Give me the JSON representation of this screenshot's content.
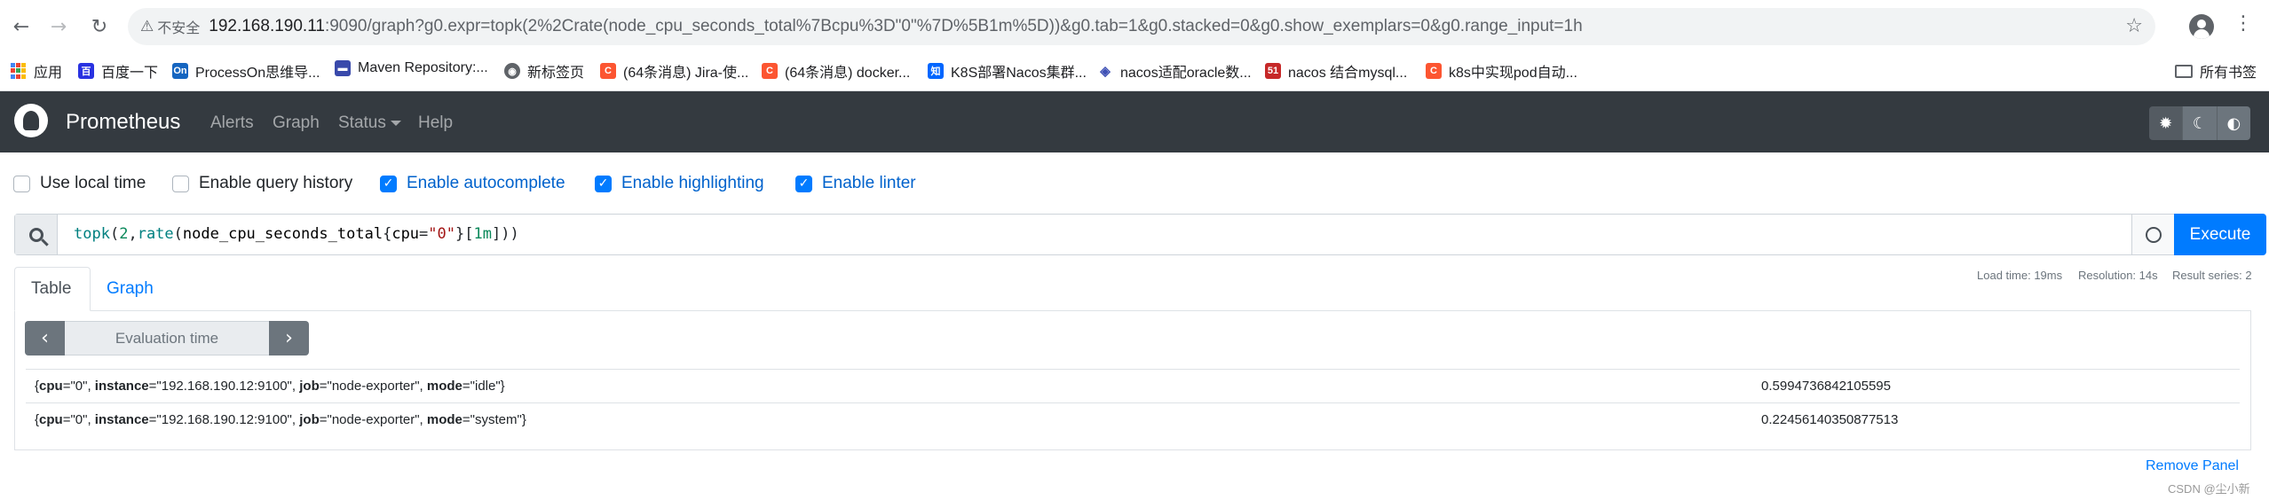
{
  "browser": {
    "insecure_label": "不安全",
    "url_host": "192.168.190.11",
    "url_rest": ":9090/graph?g0.expr=topk(2%2Crate(node_cpu_seconds_total%7Bcpu%3D\"0\"%7D%5B1m%5D))&g0.tab=1&g0.stacked=0&g0.show_exemplars=0&g0.range_input=1h",
    "icons": [
      "back-icon",
      "forward-icon",
      "reload-icon",
      "star-icon",
      "profile-icon",
      "menu-icon"
    ]
  },
  "bookmarks": {
    "items": [
      {
        "label": "应用",
        "icon": "apps-icon",
        "color": "#4285f4"
      },
      {
        "label": "百度一下",
        "icon": "baidu-icon",
        "color": "#2932e1"
      },
      {
        "label": "ProcessOn思维导...",
        "icon": "processon-icon",
        "color": "#1565c0"
      },
      {
        "label": "Maven Repository:...",
        "icon": "maven-icon",
        "color": "#3949ab"
      },
      {
        "label": "新标签页",
        "icon": "globe-icon",
        "color": "#5f6368"
      },
      {
        "label": "(64条消息) Jira-使...",
        "icon": "csdn-icon",
        "color": "#fc5531"
      },
      {
        "label": "(64条消息) docker...",
        "icon": "csdn-icon",
        "color": "#fc5531"
      },
      {
        "label": "K8S部署Nacos集群...",
        "icon": "zhihu-icon",
        "color": "#0066ff"
      },
      {
        "label": "nacos适配oracle数...",
        "icon": "diamond-icon",
        "color": "#3f51b5"
      },
      {
        "label": "nacos 结合mysql...",
        "icon": "51cto-icon",
        "color": "#c62828"
      },
      {
        "label": "k8s中实现pod自动...",
        "icon": "csdn-icon",
        "color": "#fc5531"
      }
    ],
    "all_label": "所有书签"
  },
  "navbar": {
    "brand": "Prometheus",
    "links": [
      "Alerts",
      "Graph",
      "Status",
      "Help"
    ],
    "theme_icons": [
      "sun-icon",
      "moon-icon",
      "contrast-icon"
    ]
  },
  "options": [
    {
      "label": "Use local time",
      "checked": false
    },
    {
      "label": "Enable query history",
      "checked": false
    },
    {
      "label": "Enable autocomplete",
      "checked": true
    },
    {
      "label": "Enable highlighting",
      "checked": true
    },
    {
      "label": "Enable linter",
      "checked": true
    }
  ],
  "query": {
    "expr_fn1": "topk",
    "expr_num": "2",
    "expr_fn2": "rate",
    "expr_metric": "node_cpu_seconds_total",
    "expr_label": "cpu",
    "expr_value": "\"0\"",
    "expr_range": "1m",
    "execute_label": "Execute"
  },
  "stats": {
    "load_time": "Load time: 19ms",
    "resolution": "Resolution: 14s",
    "result_series": "Result series: 2"
  },
  "panel": {
    "tabs": [
      "Table",
      "Graph"
    ],
    "eval_placeholder": "Evaluation time",
    "rows": [
      {
        "cpu": "\"0\"",
        "instance": "\"192.168.190.12:9100\"",
        "job": "\"node-exporter\"",
        "mode": "\"idle\"",
        "value": "0.5994736842105595"
      },
      {
        "cpu": "\"0\"",
        "instance": "\"192.168.190.12:9100\"",
        "job": "\"node-exporter\"",
        "mode": "\"system\"",
        "value": "0.22456140350877513"
      }
    ],
    "remove_label": "Remove Panel"
  },
  "watermark": "CSDN @尘小新",
  "colors": {
    "navbar": "#343a40",
    "primary": "#007bff",
    "secondary": "#6c757d"
  }
}
